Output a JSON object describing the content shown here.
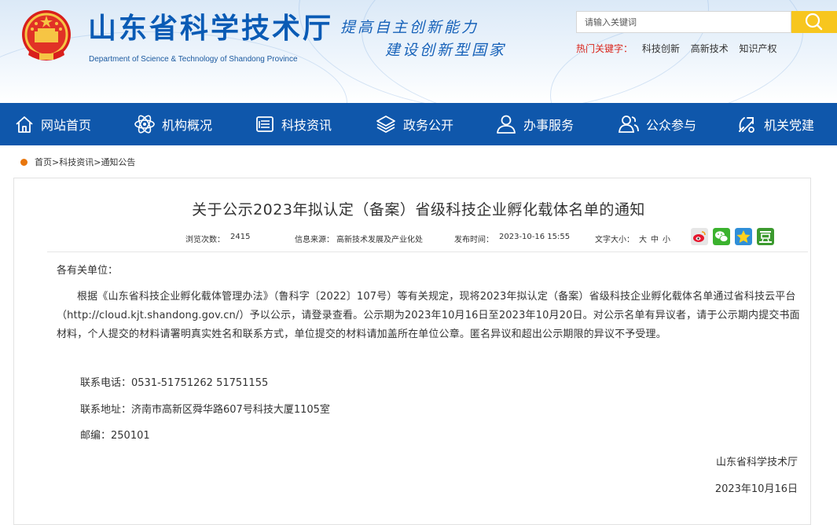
{
  "site": {
    "title": "山东省科学技术厅",
    "subtitle": "Department of Science & Technology of Shandong Province",
    "slogan_line1": "提高自主创新能力",
    "slogan_line2": "建设创新型国家"
  },
  "search": {
    "placeholder": "请输入关键词"
  },
  "hot_keywords": {
    "label": "热门关键字：",
    "items": [
      "科技创新",
      "高新技术",
      "知识产权"
    ]
  },
  "nav": {
    "items": [
      {
        "label": "网站首页",
        "icon": "home-icon"
      },
      {
        "label": "机构概况",
        "icon": "atom-icon"
      },
      {
        "label": "科技资讯",
        "icon": "news-icon"
      },
      {
        "label": "政务公开",
        "icon": "layers-icon"
      },
      {
        "label": "办事服务",
        "icon": "user-service-icon"
      },
      {
        "label": "公众参与",
        "icon": "users-icon"
      },
      {
        "label": "机关党建",
        "icon": "party-icon"
      }
    ]
  },
  "breadcrumb": {
    "home": "首页",
    "sep": ">",
    "section": "科技资讯",
    "page": "通知公告"
  },
  "article": {
    "title": "关于公示2023年拟认定（备案）省级科技企业孵化载体名单的通知",
    "views_label": "浏览次数：",
    "views": "2415",
    "source_label": "信息来源：",
    "source": "高新技术发展及产业化处",
    "date_label": "发布时间：",
    "date": "2023-10-16 15:55",
    "fontsize_label": "文字大小：",
    "font_large": "大",
    "font_medium": "中",
    "font_small": "小",
    "share_icons": [
      "weibo-icon",
      "wechat-icon",
      "qzone-icon",
      "douban-icon"
    ],
    "intro": "各有关单位：",
    "main_paragraph": "根据《山东省科技企业孵化载体管理办法》（鲁科字〔2022〕107号）等有关规定，现将2023年拟认定（备案）省级科技企业孵化载体名单通过省科技云平台（http://cloud.kjt.shandong.gov.cn/）予以公示，请登录查看。公示期为2023年10月16日至2023年10月20日。对公示名单有异议者，请于公示期内提交书面材料，个人提交的材料请署明真实姓名和联系方式，单位提交的材料请加盖所在单位公章。匿名异议和超出公示期限的异议不予受理。",
    "phone": "联系电话：0531-51751262 51751155",
    "address": "联系地址：济南市高新区舜华路607号科技大厦1105室",
    "zip": "邮编：250101",
    "signature": "山东省科学技术厅",
    "sign_date": "2023年10月16日"
  },
  "colors": {
    "brand_blue": "#0f57ab",
    "search_button": "#f7c61e",
    "hot_label": "#d9251c",
    "breadcrumb_dot": "#e8760d"
  }
}
